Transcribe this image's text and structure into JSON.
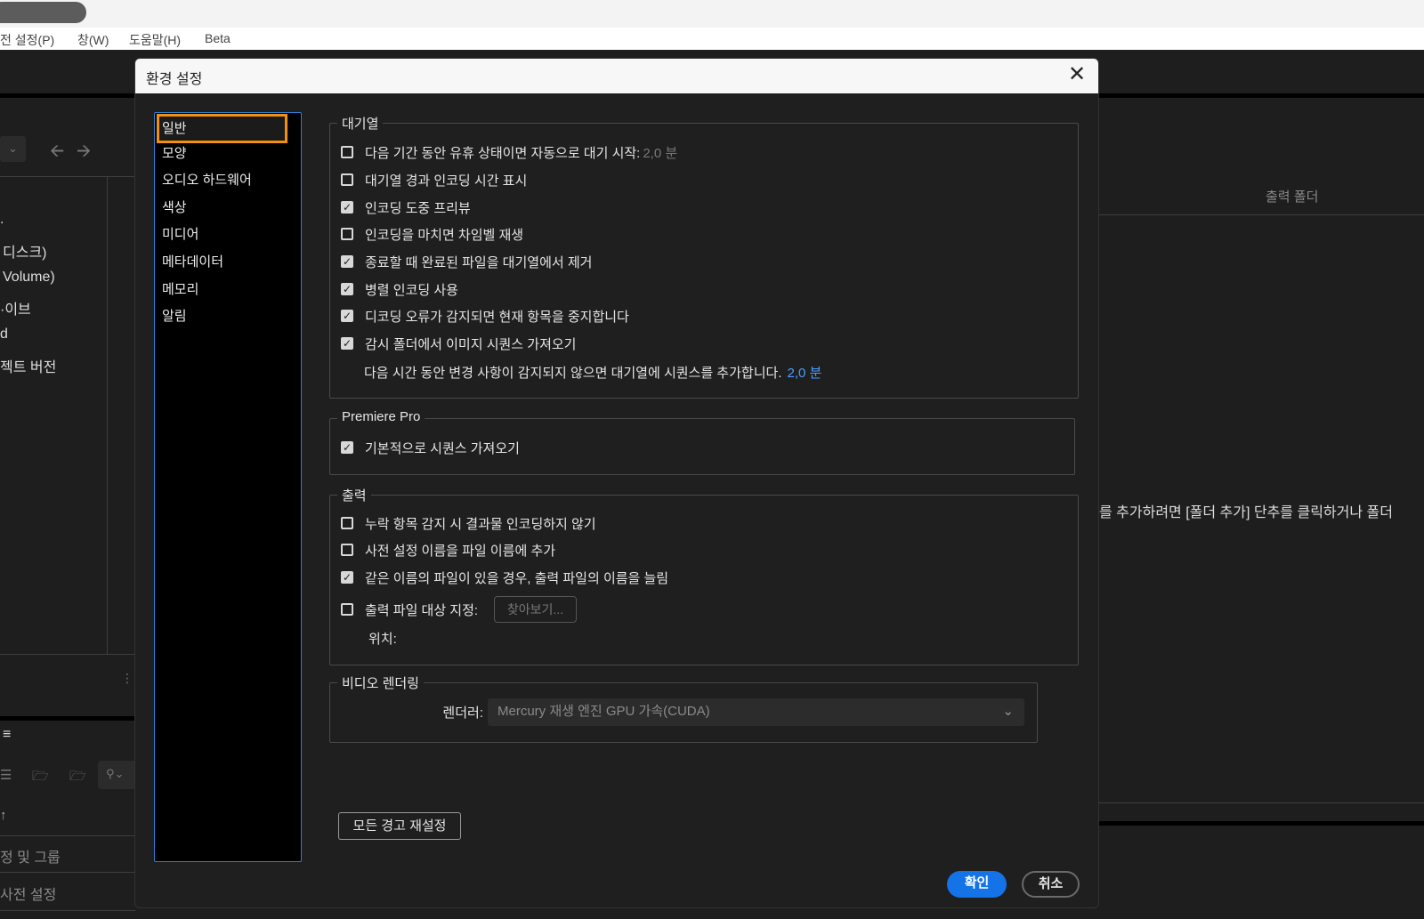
{
  "menubar": {
    "items": [
      "전 설정(P)",
      "창(W)",
      "도움말(H)",
      "Beta"
    ]
  },
  "background": {
    "left_panel_items": [
      ".",
      "디스크)",
      "Volume)",
      "·이브",
      "d",
      "젝트 버전"
    ],
    "bottom_rows": [
      "정 및 그룹",
      "사전 설정"
    ],
    "output_folder_header": "출력 폴더",
    "hint_text": "를 추가하려면 [폴더 추가] 단추를 클릭하거나 폴더"
  },
  "dialog": {
    "title": "환경 설정",
    "nav": [
      "일반",
      "모양",
      "오디오 하드웨어",
      "색상",
      "미디어",
      "메타데이터",
      "메모리",
      "알림"
    ],
    "queue": {
      "legend": "대기열",
      "rows": [
        {
          "label": "다음 기간 동안 유휴 상태이면 자동으로 대기 시작:",
          "checked": false,
          "value": "2,0 분"
        },
        {
          "label": "대기열 경과 인코딩 시간 표시",
          "checked": false
        },
        {
          "label": "인코딩 도중 프리뷰",
          "checked": true
        },
        {
          "label": "인코딩을 마치면 차임벨 재생",
          "checked": false
        },
        {
          "label": "종료할 때 완료된 파일을 대기열에서 제거",
          "checked": true
        },
        {
          "label": "병렬 인코딩 사용",
          "checked": true
        },
        {
          "label": "디코딩 오류가 감지되면 현재 항목을 중지합니다",
          "checked": true
        },
        {
          "label": "감시 폴더에서 이미지 시퀀스 가져오기",
          "checked": true
        }
      ],
      "sequence_note": "다음 시간 동안 변경 사항이 감지되지 않으면 대기열에 시퀀스를 추가합니다.",
      "sequence_value": "2,0 분"
    },
    "premiere": {
      "legend": "Premiere Pro",
      "rows": [
        {
          "label": "기본적으로 시퀀스 가져오기",
          "checked": true
        }
      ]
    },
    "output": {
      "legend": "출력",
      "rows": [
        {
          "label": "누락 항목 감지 시 결과물 인코딩하지 않기",
          "checked": false
        },
        {
          "label": "사전 설정 이름을 파일 이름에 추가",
          "checked": false
        },
        {
          "label": "같은 이름의 파일이 있을 경우, 출력 파일의 이름을 늘림",
          "checked": true
        },
        {
          "label": "출력 파일 대상 지정:",
          "checked": false
        }
      ],
      "browse_label": "찾아보기...",
      "location_label": "위치:"
    },
    "video": {
      "legend": "비디오 렌더링",
      "renderer_label": "렌더러:",
      "renderer_value": "Mercury 재생 엔진 GPU 가속(CUDA)"
    },
    "reset_label": "모든 경고 재설정",
    "ok_label": "확인",
    "cancel_label": "취소"
  },
  "colors": {
    "accent": "#1473e6",
    "selection": "#f5900e",
    "nav_border": "#2d7fd6"
  }
}
